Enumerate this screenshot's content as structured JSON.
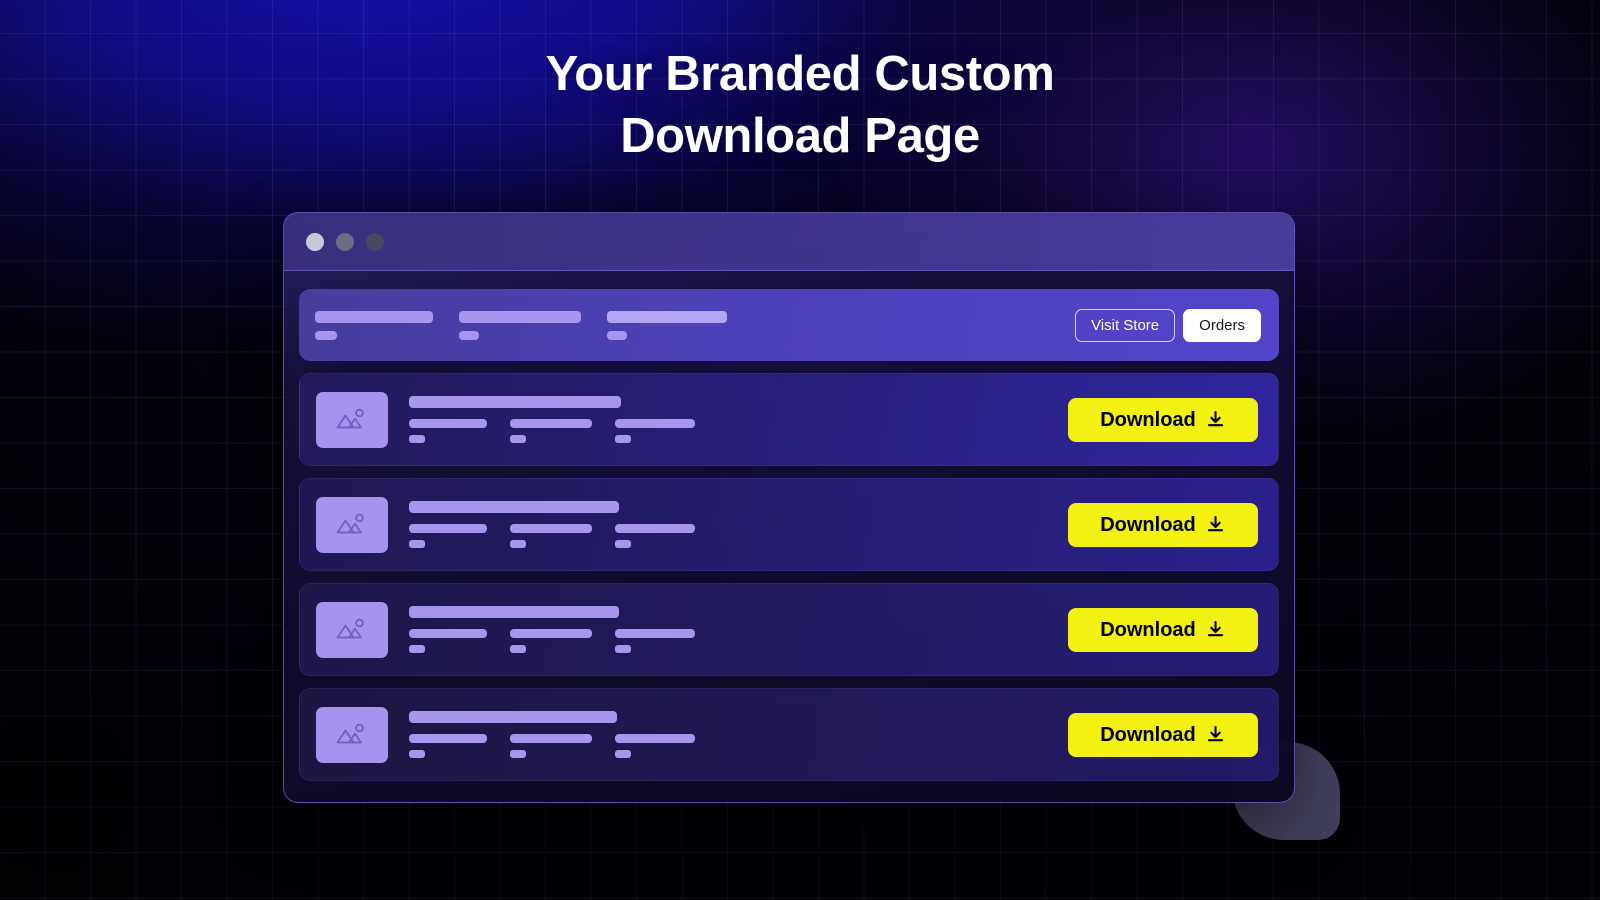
{
  "headline": {
    "line1": "Your Branded Custom",
    "line2": "Download Page"
  },
  "colors": {
    "accent_yellow": "#F2F112",
    "brand_purple": "#5846CC",
    "skeleton_purple": "#A896EE",
    "thumb_purple": "#A693F0",
    "background_blue": "#1B12C8",
    "background_dark": "#04020C",
    "swoosh_gray": "#474563"
  },
  "window": {
    "titlebar": {
      "dots": [
        {
          "name": "close-dot",
          "color": "#C8C8D8"
        },
        {
          "name": "minimize-dot",
          "color": "#6D6A85"
        },
        {
          "name": "maximize-dot",
          "color": "#4A4760"
        }
      ]
    },
    "store_header": {
      "skeleton_columns": [
        {
          "title_width": 118,
          "sub_width": 22
        },
        {
          "title_width": 122,
          "sub_width": 20
        },
        {
          "title_width": 120,
          "sub_width": 20
        }
      ],
      "visit_store_label": "Visit Store",
      "orders_label": "Orders"
    },
    "rows": [
      {
        "thumbnail_icon": "image-placeholder-icon",
        "title_width": 212,
        "download_label": "Download",
        "download_icon": "download-icon"
      },
      {
        "thumbnail_icon": "image-placeholder-icon",
        "title_width": 210,
        "download_label": "Download",
        "download_icon": "download-icon"
      },
      {
        "thumbnail_icon": "image-placeholder-icon",
        "title_width": 210,
        "download_label": "Download",
        "download_icon": "download-icon"
      },
      {
        "thumbnail_icon": "image-placeholder-icon",
        "title_width": 208,
        "download_label": "Download",
        "download_icon": "download-icon"
      }
    ]
  }
}
